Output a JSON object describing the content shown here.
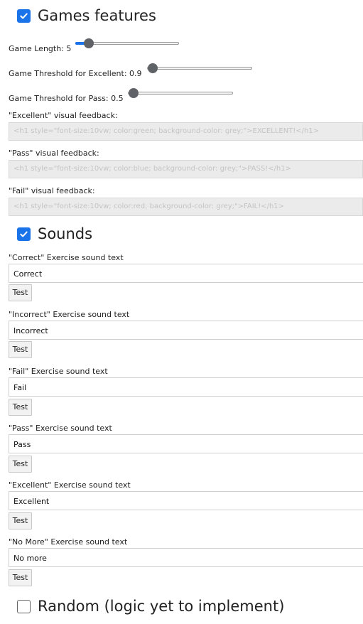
{
  "games": {
    "header": "Games features",
    "checked": true,
    "length": {
      "label": "Game Length: 5",
      "value": 5,
      "fraction": 0.11
    },
    "excellent_threshold": {
      "label": "Game Threshold for Excellent: 0.9",
      "value": 0.9,
      "fraction": 0.1
    },
    "pass_threshold": {
      "label": "Game Threshold for Pass: 0.5",
      "value": 0.5,
      "fraction": 0.1
    },
    "feedback": [
      {
        "label": "\"Excellent\" visual feedback:",
        "placeholder": "<h1 style=\"font-size:10vw; color:green; background-color: grey;\">EXCELLENT!</h1>"
      },
      {
        "label": "\"Pass\" visual feedback:",
        "placeholder": "<h1 style=\"font-size:10vw; color:blue; background-color: grey;\">PASS!</h1>"
      },
      {
        "label": "\"Fail\" visual feedback:",
        "placeholder": "<h1 style=\"font-size:10vw; color:red; background-color: grey;\">FAIL!</h1>"
      }
    ]
  },
  "sounds": {
    "header": "Sounds",
    "checked": true,
    "test_label": "Test",
    "items": [
      {
        "label": "\"Correct\" Exercise sound text",
        "value": "Correct"
      },
      {
        "label": "\"Incorrect\" Exercise sound text",
        "value": "Incorrect"
      },
      {
        "label": "\"Fail\" Exercise sound text",
        "value": "Fail"
      },
      {
        "label": "\"Pass\" Exercise sound text",
        "value": "Pass"
      },
      {
        "label": "\"Excellent\" Exercise sound text",
        "value": "Excellent"
      },
      {
        "label": "\"No More\" Exercise sound text",
        "value": "No more"
      }
    ]
  },
  "random": {
    "header": "Random (logic yet to implement)",
    "checked": false
  },
  "colors": {
    "accent": "#1a73e8",
    "thumb": "#5f6368"
  }
}
